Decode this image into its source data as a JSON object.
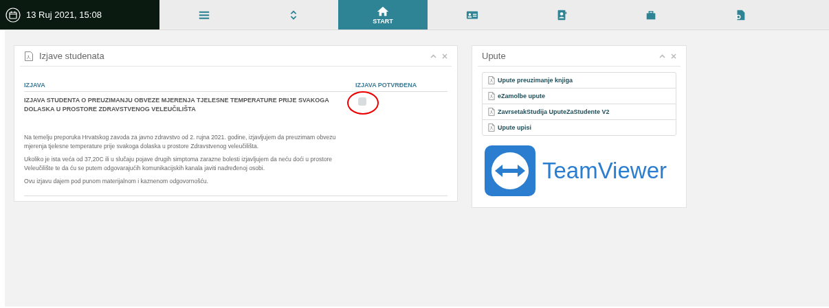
{
  "top_bar": {
    "datetime": "13 Ruj 2021, 15:08",
    "tabs": [
      {
        "kind": "menu",
        "selected": false
      },
      {
        "kind": "updown",
        "selected": false
      },
      {
        "kind": "home",
        "label": "START",
        "selected": true
      },
      {
        "kind": "idcard",
        "selected": false
      },
      {
        "kind": "contact",
        "selected": false
      },
      {
        "kind": "folder",
        "selected": false
      },
      {
        "kind": "docpin",
        "selected": false
      }
    ]
  },
  "statements_panel": {
    "title": "Izjave studenata",
    "columns": [
      "IZJAVA",
      "IZJAVA POTVRĐENA"
    ],
    "rows": [
      {
        "title": "IZJAVA STUDENTA O PREUZIMANJU OBVEZE MJERENJA TJELESNE TEMPERATURE PRIJE SVAKOGA DOLASKA U PROSTORE ZDRAVSTVENOG VELEUČILIŠTA",
        "paragraphs": [
          "Na temelju preporuka Hrvatskog zavoda za javno zdravstvo od 2. rujna 2021. godine, izjavljujem da preuzimam obvezu mjerenja tjelesne temperature prije svakoga dolaska u prostore Zdravstvenog veleučilišta.",
          "Ukoliko je ista veća od 37,20C ili u slučaju pojave drugih simptoma zarazne bolesti izjavljujem da neću doći u prostore Veleučilište te da ću se putem odgovarajućih komunikacijskih kanala javiti nadređenoj osobi.",
          "Ovu izjavu dajem pod punom materijalnom i kaznenom odgovornošću."
        ],
        "confirmed": false,
        "circled": true
      }
    ]
  },
  "instructions_panel": {
    "title": "Upute",
    "links": [
      "Upute preuzimanje knjiga",
      "eZamolbe upute",
      "ZavrsetakStudija UputeZaStudente V2",
      "Upute upisi"
    ],
    "logo_text": "TeamViewer"
  }
}
